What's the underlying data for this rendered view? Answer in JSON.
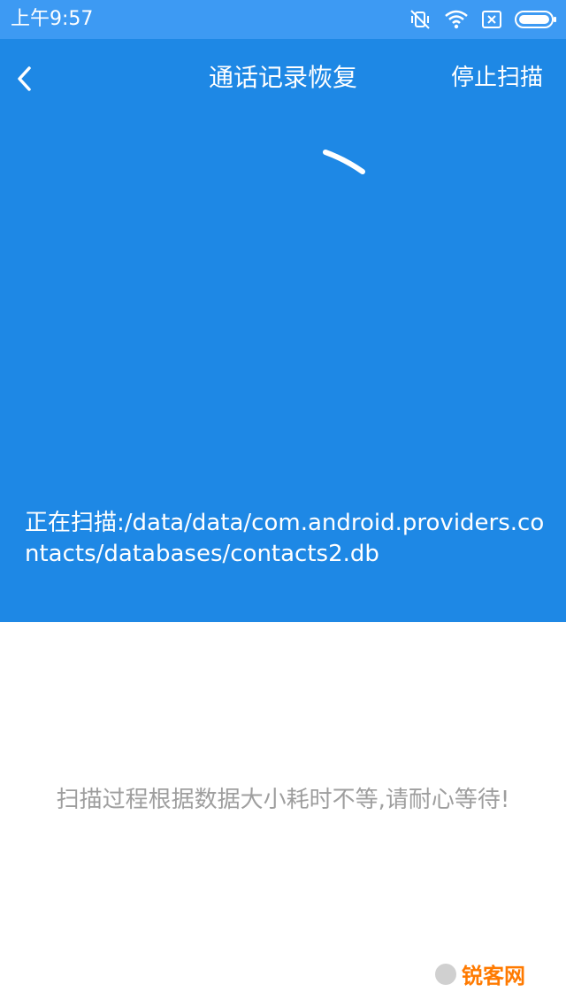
{
  "status_bar": {
    "time": "上午9:57",
    "icons": [
      "mute-vibrate-icon",
      "wifi-icon",
      "sim-blocked-icon",
      "battery-icon"
    ]
  },
  "header": {
    "back_icon": "chevron-left-icon",
    "title": "通话记录恢复",
    "stop_label": "停止扫描"
  },
  "scan": {
    "prefix": "正在扫描:",
    "path": "/data/data/com.android.providers.contacts/databases/contacts2.db"
  },
  "message": "扫描过程根据数据大小耗时不等,请耐心等待!",
  "watermark": {
    "text": "锐客网"
  },
  "colors": {
    "status_bar": "#3d9af3",
    "primary": "#1e88e5",
    "message_text": "#9e9e9e",
    "watermark": "#ff7a00"
  }
}
